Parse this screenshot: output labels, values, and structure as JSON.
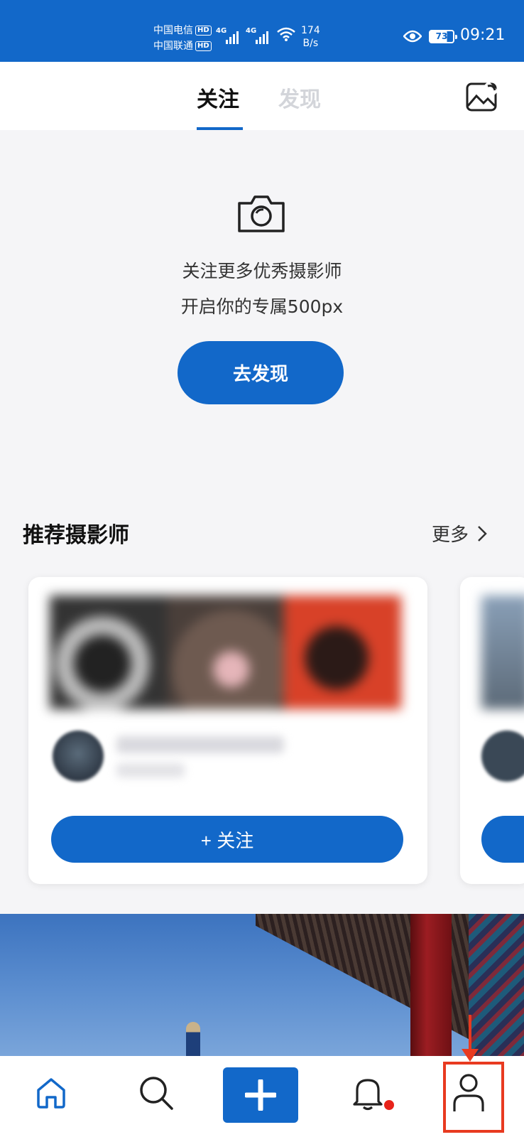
{
  "status_bar": {
    "carrier1": "中国电信",
    "carrier2": "中国联通",
    "hd": "HD",
    "network1": "4G",
    "network2": "4G",
    "speed_value": "174",
    "speed_unit": "B/s",
    "battery": "73",
    "time": "09:21"
  },
  "header": {
    "tabs": [
      {
        "label": "关注",
        "active": true
      },
      {
        "label": "发现",
        "active": false
      }
    ],
    "photo_icon": "image-edit-icon"
  },
  "empty_state": {
    "icon": "camera-icon",
    "line1": "关注更多优秀摄影师",
    "line2": "开启你的专属500px",
    "button_label": "去发现"
  },
  "recommended": {
    "title": "推荐摄影师",
    "more_label": "更多",
    "follow_label": "+ 关注"
  },
  "bottom_nav": {
    "items": [
      {
        "icon": "home-icon",
        "active": true
      },
      {
        "icon": "search-icon"
      },
      {
        "icon": "plus-icon"
      },
      {
        "icon": "bell-icon",
        "badge": true
      },
      {
        "icon": "profile-icon"
      }
    ]
  },
  "colors": {
    "brand": "#1268c9",
    "badge": "#e8231a",
    "annotation": "#e83a20"
  }
}
